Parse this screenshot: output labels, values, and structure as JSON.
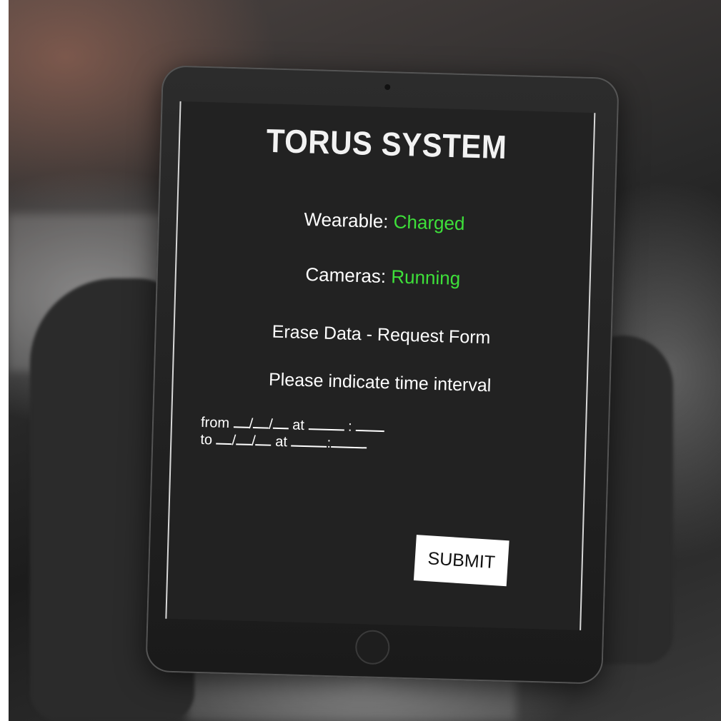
{
  "screen": {
    "title": "TORUS SYSTEM",
    "wearable": {
      "label": "Wearable:",
      "status": "Charged"
    },
    "cameras": {
      "label": "Cameras:",
      "status": "Running"
    },
    "form_title": "Erase Data - Request Form",
    "instruction": "Please indicate time interval",
    "from_label": "from",
    "to_label": "to",
    "at_label": "at",
    "date_sep": "/",
    "time_sep": ":",
    "submit_label": "SUBMIT"
  },
  "colors": {
    "status_ok": "#3ee03a",
    "screen_bg": "#222222",
    "button_bg": "#ffffff"
  }
}
